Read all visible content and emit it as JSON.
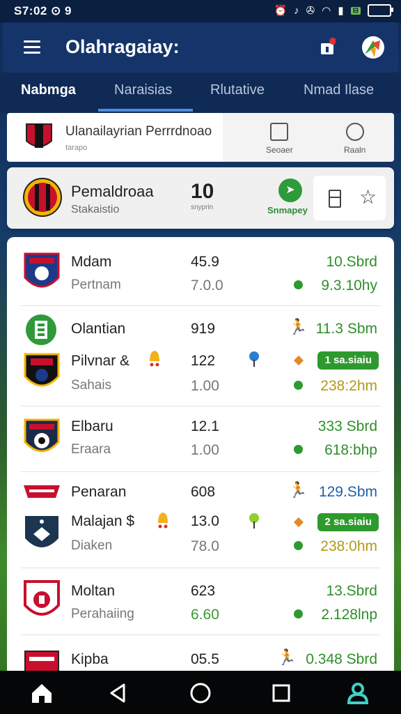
{
  "status": {
    "time": "S7:02 ⊙ 9"
  },
  "appbar": {
    "title": "Olahragaiay:"
  },
  "tabs": [
    {
      "label": "Nabmga",
      "active": true
    },
    {
      "label": "Naraisias",
      "active": false
    },
    {
      "label": "Rlutative",
      "active": false
    },
    {
      "label": "Nmad Ilase",
      "active": false
    }
  ],
  "header_card": {
    "title": "Ulanailayrian Perrrdnoao",
    "subtitle": "tarapo",
    "tool1": "Seoaer",
    "tool2": "Raaln"
  },
  "featured": {
    "team": "Pemaldroaa",
    "sub": "Stakaistio",
    "score": "10",
    "score_sub": "snyprin",
    "action_label": "Snmapey"
  },
  "rows": [
    {
      "name": "Mdam",
      "sub": "Pertnam",
      "n1": "45.9",
      "n2": "7.0.0",
      "v1": "10.Sbrd",
      "v2": "9.3.10hy"
    },
    {
      "name": "Olantian",
      "n1": "919",
      "v1": "11.3 Sbm"
    },
    {
      "name": "Pilvnar &",
      "sub": "Sahais",
      "n1": "122",
      "n2": "1.00",
      "pill": "1 sa.siaiu",
      "v2": "238:2hm"
    },
    {
      "name": "Elbaru",
      "sub": "Eraara",
      "n1": "12.1",
      "n2": "1.00",
      "v1": "333 Sbrd",
      "v2": "618:bhp"
    },
    {
      "name": "Penaran",
      "n1": "608",
      "v1": "129.Sbm"
    },
    {
      "name": "Malajan $",
      "sub": "Diaken",
      "n1": "13.0",
      "n2": "78.0",
      "pill": "2 sa.siaiu",
      "v2": "238:0hm"
    },
    {
      "name": "Moltan",
      "sub": "Perahaiing",
      "n1": "623",
      "n2": "6.60",
      "v1": "13.Sbrd",
      "v2": "2.128lnp"
    },
    {
      "name": "Kipba",
      "n1": "05.5",
      "v1": "0.348 Sbrd"
    }
  ],
  "colors": {
    "primary": "#14346a",
    "accent_green": "#2e9a2e",
    "accent_blue": "#4d8de0"
  }
}
